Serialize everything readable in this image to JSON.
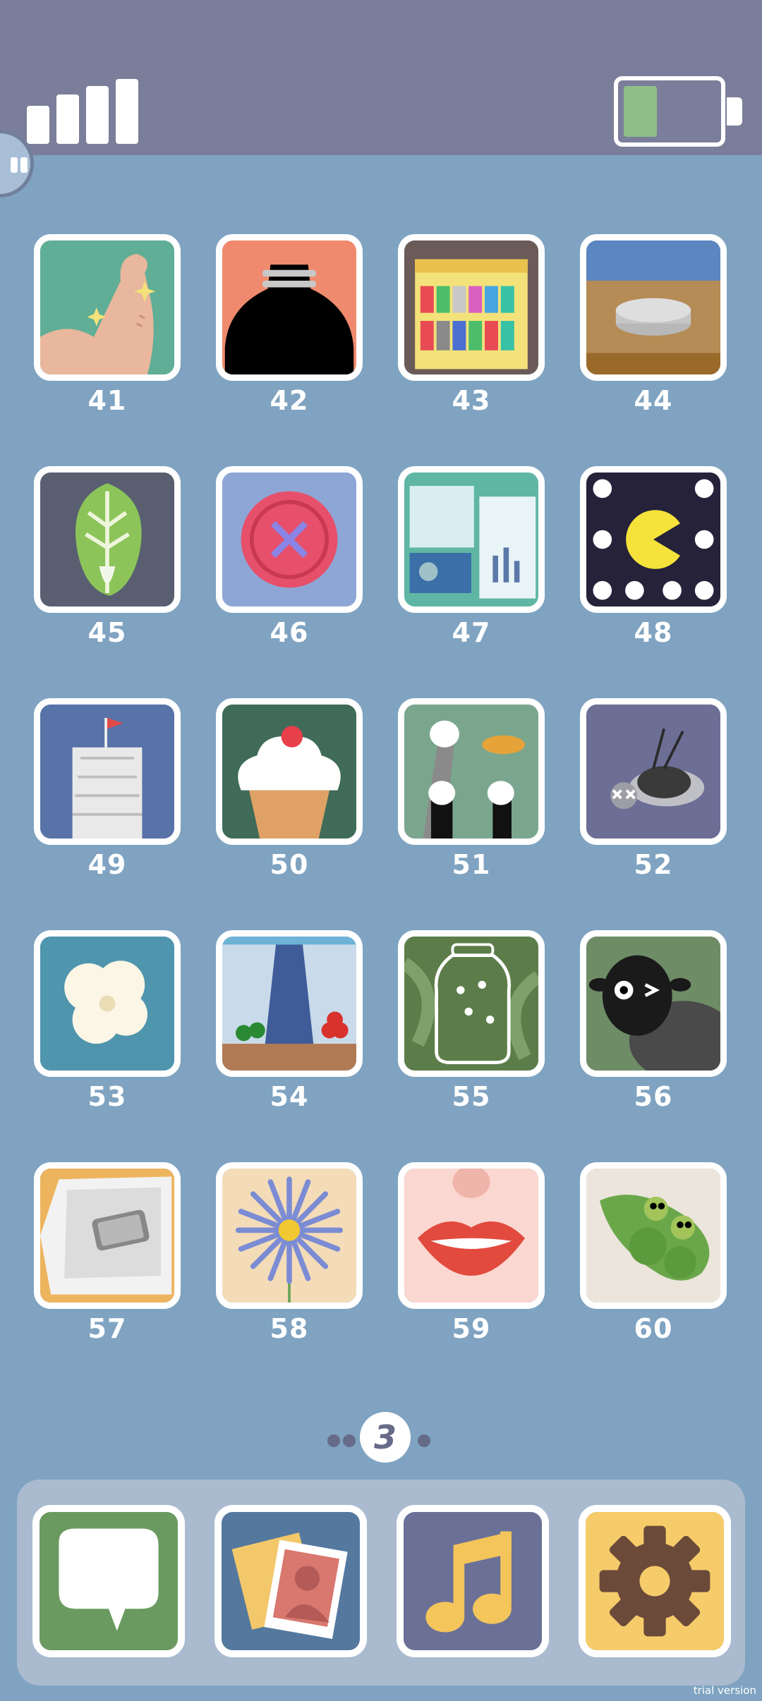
{
  "status": {
    "signal_icon": "signal-bars-icon",
    "battery_icon": "battery-icon",
    "battery_fraction": 0.35
  },
  "pause_icon": "pause-icon",
  "levels": [
    {
      "number": "41",
      "icon": "flexed-arm-icon"
    },
    {
      "number": "42",
      "icon": "black-bottle-icon"
    },
    {
      "number": "43",
      "icon": "crayon-box-icon"
    },
    {
      "number": "44",
      "icon": "coin-stack-icon"
    },
    {
      "number": "45",
      "icon": "napa-cabbage-icon"
    },
    {
      "number": "46",
      "icon": "pink-button-icon"
    },
    {
      "number": "47",
      "icon": "desk-papers-icon"
    },
    {
      "number": "48",
      "icon": "pacman-icon"
    },
    {
      "number": "49",
      "icon": "leaning-tower-icon"
    },
    {
      "number": "50",
      "icon": "sundae-icon"
    },
    {
      "number": "51",
      "icon": "cat-paws-fish-icon"
    },
    {
      "number": "52",
      "icon": "dead-fly-icon"
    },
    {
      "number": "53",
      "icon": "popcorn-icon"
    },
    {
      "number": "54",
      "icon": "green-red-balls-icon"
    },
    {
      "number": "55",
      "icon": "firefly-jar-icon"
    },
    {
      "number": "56",
      "icon": "black-sheep-icon"
    },
    {
      "number": "57",
      "icon": "phone-in-tray-icon"
    },
    {
      "number": "58",
      "icon": "blue-flower-icon"
    },
    {
      "number": "59",
      "icon": "lips-icon"
    },
    {
      "number": "60",
      "icon": "pea-pod-icon"
    }
  ],
  "pager": {
    "current_page": "3"
  },
  "dock": [
    {
      "name": "messages",
      "icon": "speech-bubble-icon",
      "color": "#6a9a60"
    },
    {
      "name": "photos",
      "icon": "photo-contact-icon",
      "color": "#55789e"
    },
    {
      "name": "music",
      "icon": "music-note-icon",
      "color": "#6b7096"
    },
    {
      "name": "settings",
      "icon": "gear-icon",
      "color": "#f6cc6a"
    }
  ],
  "watermark": "trial version"
}
